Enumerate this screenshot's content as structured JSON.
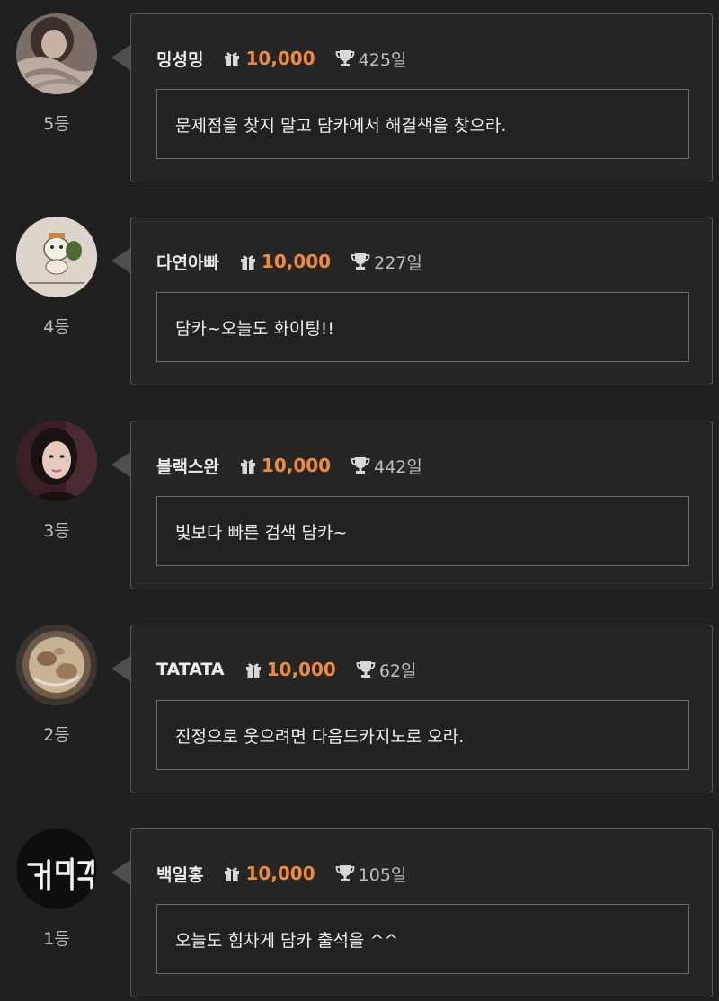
{
  "entries": [
    {
      "user": "밍성밍",
      "gift": "10,000",
      "days": "425일",
      "comment": "문제점을 찾지 말고 담카에서 해결책을 찾으라.",
      "rank": "5등",
      "avatar_icon": "profile-photo-girl-with-stuffed-toy"
    },
    {
      "user": "다연아빠",
      "gift": "10,000",
      "days": "227일",
      "comment": "담카~오늘도 화이팅!!",
      "rank": "4등",
      "avatar_icon": "profile-photo-cartoon-drawing"
    },
    {
      "user": "블랙스완",
      "gift": "10,000",
      "days": "442일",
      "comment": "빛보다 빠른 검색 담카~",
      "rank": "3등",
      "avatar_icon": "profile-photo-woman-portrait"
    },
    {
      "user": "TATATA",
      "gift": "10,000",
      "days": "62일",
      "comment": "진정으로 웃으려면 다음드카지노로 오라.",
      "rank": "2등",
      "avatar_icon": "profile-photo-food-bowl"
    },
    {
      "user": "백일홍",
      "gift": "10,000",
      "days": "105일",
      "comment": "오늘도 힘차게 담카 출석을 ^^",
      "rank": "1등",
      "avatar_icon": "profile-photo-neon-sign"
    }
  ],
  "icons": {
    "gift": "gift-icon",
    "trophy": "trophy-icon"
  },
  "colors": {
    "background": "#202020",
    "card_border": "#595959",
    "accent": "#f08a3c"
  }
}
